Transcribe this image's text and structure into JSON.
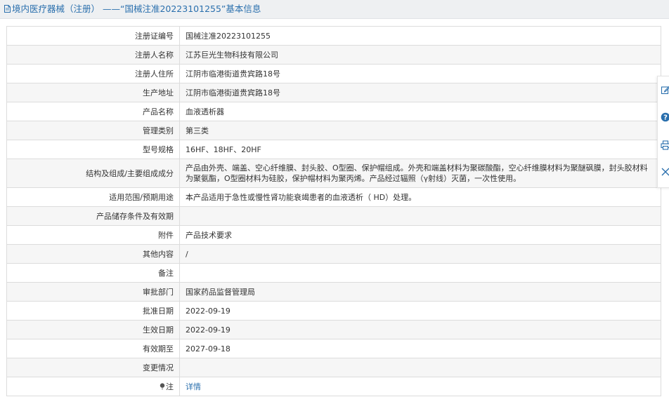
{
  "header": {
    "title": "境内医疗器械（注册） ——“国械注准20223101255”基本信息",
    "icon": "document-icon"
  },
  "rows": [
    {
      "label": "注册证编号",
      "value": "国械注准20223101255"
    },
    {
      "label": "注册人名称",
      "value": "江苏巨光生物科技有限公司"
    },
    {
      "label": "注册人住所",
      "value": "江阴市临港街道贵宾路18号"
    },
    {
      "label": "生产地址",
      "value": "江阴市临港街道贵宾路18号"
    },
    {
      "label": "产品名称",
      "value": "血液透析器"
    },
    {
      "label": "管理类别",
      "value": "第三类"
    },
    {
      "label": "型号规格",
      "value": "16HF、18HF、20HF"
    },
    {
      "label": "结构及组成/主要组成成分",
      "value": "产品由外壳、端盖、空心纤维膜、封头胶、O型圈、保护帽组成。外壳和端盖材料为聚碳酸酯，空心纤维膜材料为聚醚砜膜，封头胶材料为聚氨酯，O型圈材料为硅胶，保护帽材料为聚丙烯。产品经过辐照（γ射线）灭菌，一次性使用。"
    },
    {
      "label": "适用范围/预期用途",
      "value": "本产品适用于急性或慢性肾功能衰竭患者的血液透析（ HD）处理。"
    },
    {
      "label": "产品储存条件及有效期",
      "value": ""
    },
    {
      "label": "附件",
      "value": "产品技术要求"
    },
    {
      "label": "其他内容",
      "value": "/"
    },
    {
      "label": "备注",
      "value": ""
    },
    {
      "label": "审批部门",
      "value": "国家药品监督管理局"
    },
    {
      "label": "批准日期",
      "value": "2022-09-19"
    },
    {
      "label": "生效日期",
      "value": "2022-09-19"
    },
    {
      "label": "有效期至",
      "value": "2027-09-18"
    },
    {
      "label": "变更情况",
      "value": ""
    },
    {
      "label": "注",
      "value": "详情"
    }
  ],
  "side_tools": [
    "edit-icon",
    "help-icon",
    "print-icon",
    "close-icon"
  ],
  "colors": {
    "link": "#2a6fad",
    "header_bg": "#eef0f2",
    "border": "#dcdcdc",
    "row_alt": "#f6f6f6"
  }
}
